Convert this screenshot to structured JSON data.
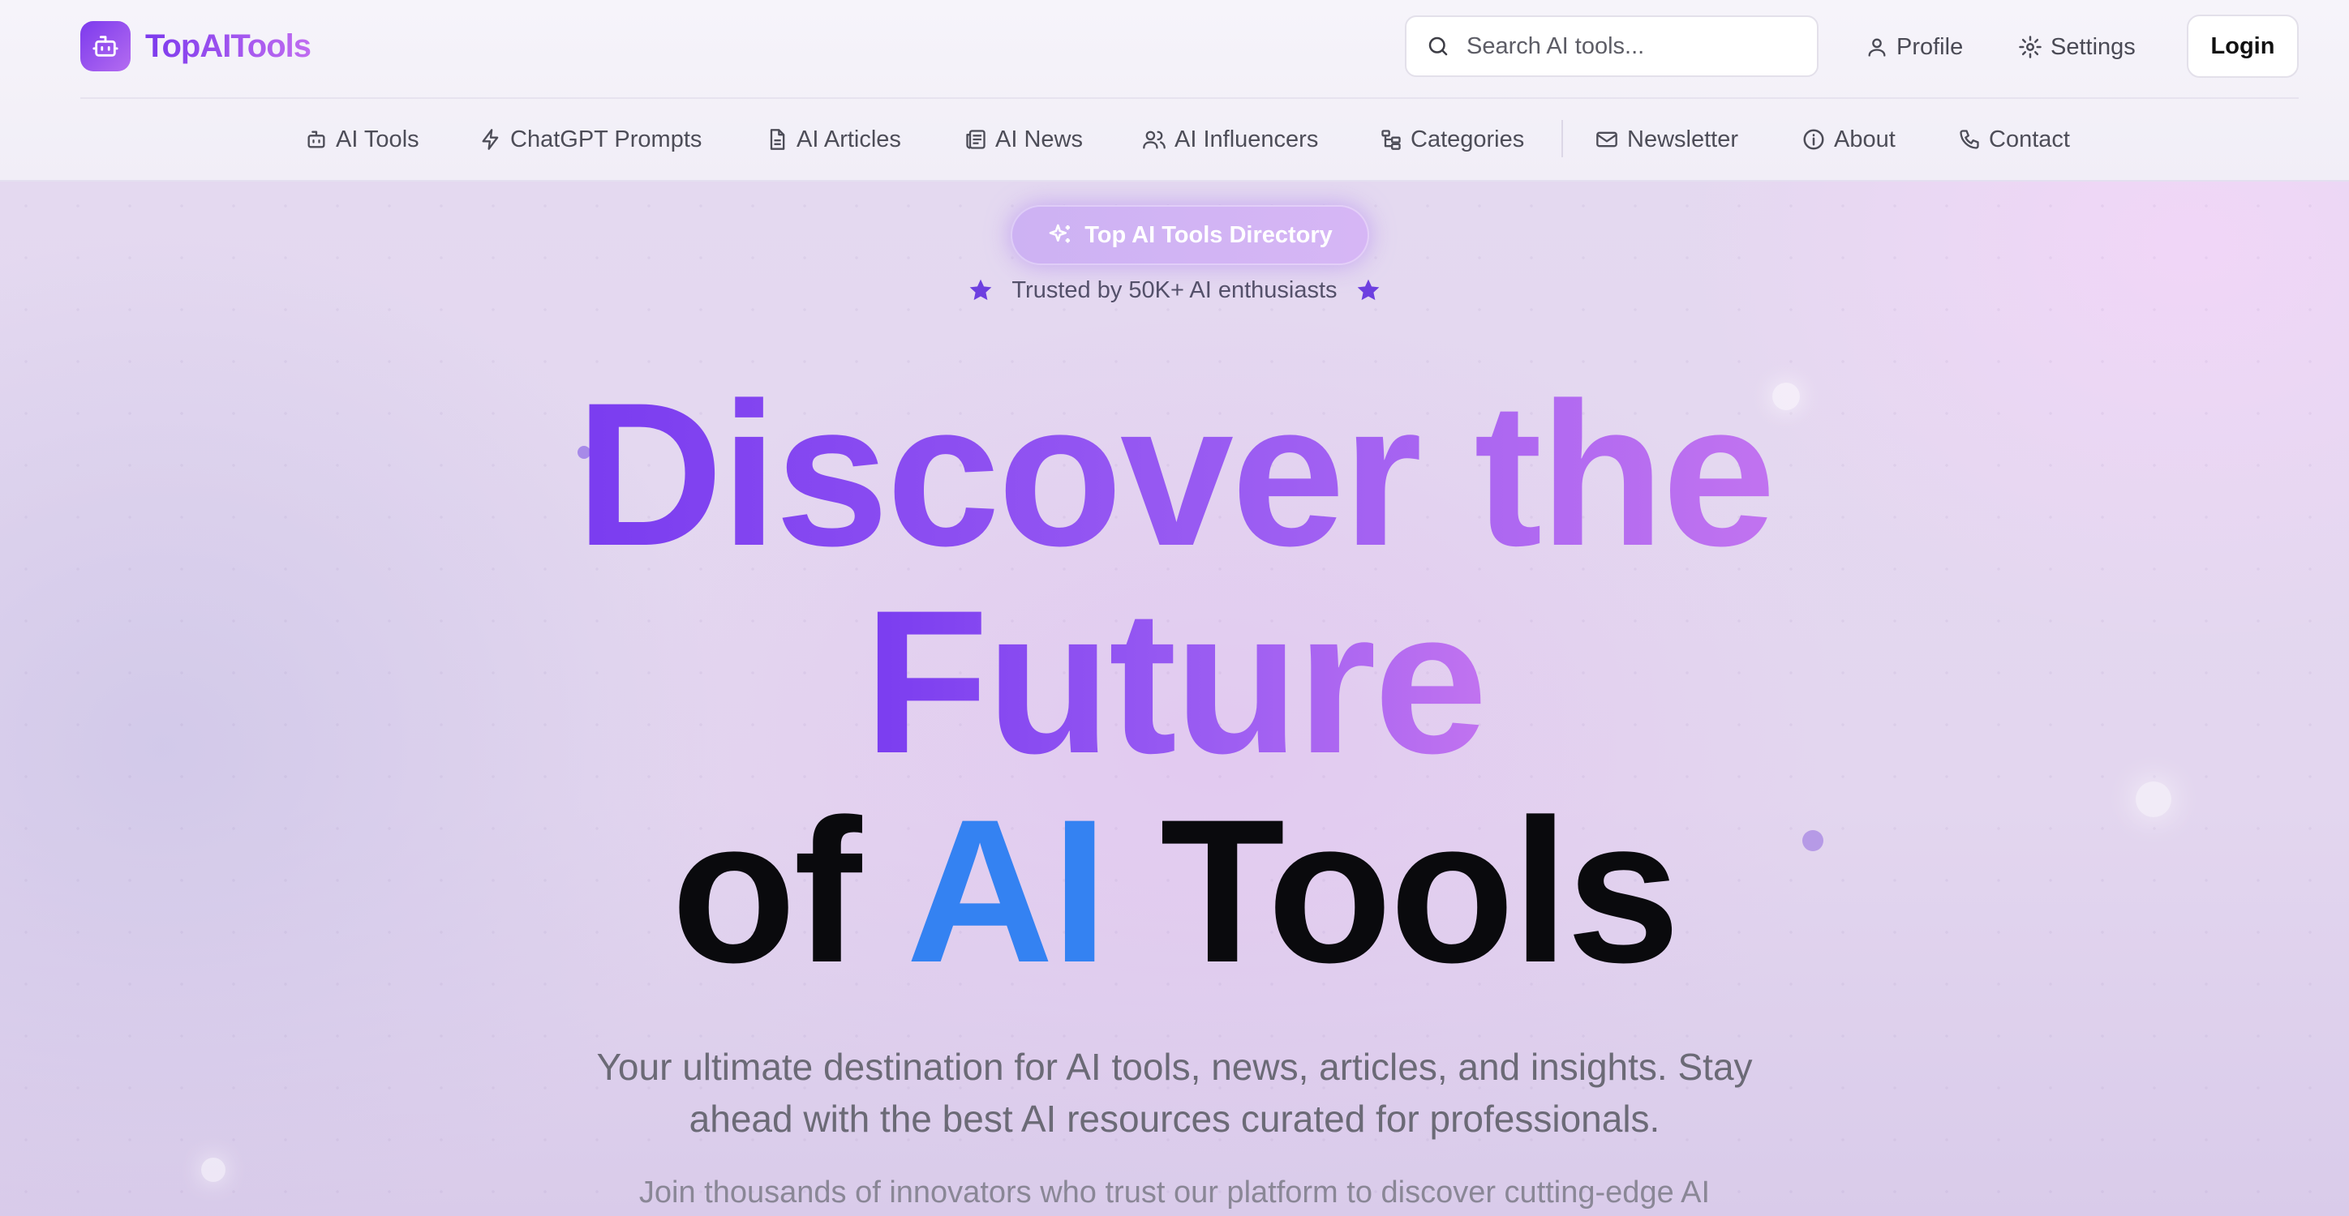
{
  "brand": {
    "name": "TopAITools"
  },
  "search": {
    "placeholder": "Search AI tools..."
  },
  "top_links": {
    "profile": "Profile",
    "settings": "Settings",
    "login": "Login"
  },
  "nav": {
    "items": [
      {
        "label": "AI Tools",
        "icon": "robot-icon"
      },
      {
        "label": "ChatGPT Prompts",
        "icon": "lightning-icon"
      },
      {
        "label": "AI Articles",
        "icon": "document-icon"
      },
      {
        "label": "AI News",
        "icon": "newspaper-icon"
      },
      {
        "label": "AI Influencers",
        "icon": "users-icon"
      },
      {
        "label": "Categories",
        "icon": "folder-tree-icon"
      },
      {
        "label": "Newsletter",
        "icon": "mail-icon"
      },
      {
        "label": "About",
        "icon": "info-icon"
      },
      {
        "label": "Contact",
        "icon": "phone-icon"
      }
    ]
  },
  "hero": {
    "badge": "Top AI Tools Directory",
    "trusted": "Trusted by 50K+ AI enthusiasts",
    "headline": {
      "line1": "Discover the",
      "line2": "Future",
      "line3_part1": "of",
      "line3_highlight": "AI",
      "line3_part2": "Tools"
    },
    "subtitle_line1": "Your ultimate destination for AI tools, news, articles, and insights. Stay",
    "subtitle_line2": "ahead with the best AI resources curated for professionals.",
    "subtitle2": "Join thousands of innovators who trust our platform to discover cutting-edge AI"
  },
  "colors": {
    "accent": "#7c3aed",
    "accent_light": "#c06cf0",
    "blue": "#3482f2",
    "star": "#6d3fe0"
  }
}
